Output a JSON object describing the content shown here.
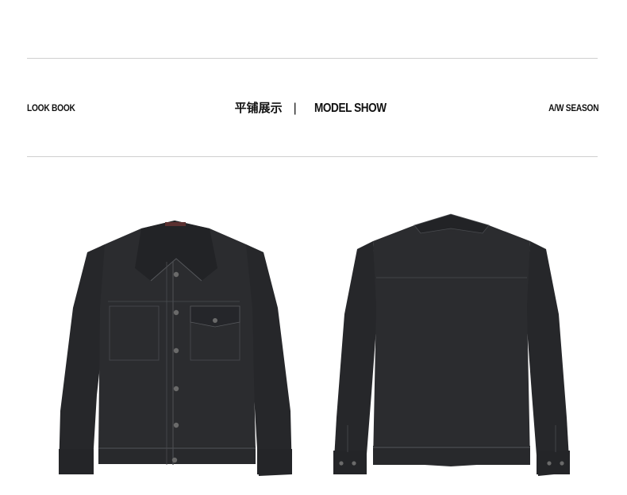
{
  "header": {
    "left_label": "LOOK BOOK",
    "center_zh": "平铺展示",
    "center_separator": "|",
    "center_en": "MODEL SHOW",
    "right_label": "A/W SEASON"
  },
  "images": [
    {
      "name": "jacket-front",
      "color": "#2a2b2e"
    },
    {
      "name": "jacket-back",
      "color": "#2a2b2e"
    }
  ],
  "colors": {
    "rule": "#cfcfcf",
    "fabric": "#2a2b2e",
    "stitch": "#55575b",
    "button": "#6a6a6a"
  }
}
